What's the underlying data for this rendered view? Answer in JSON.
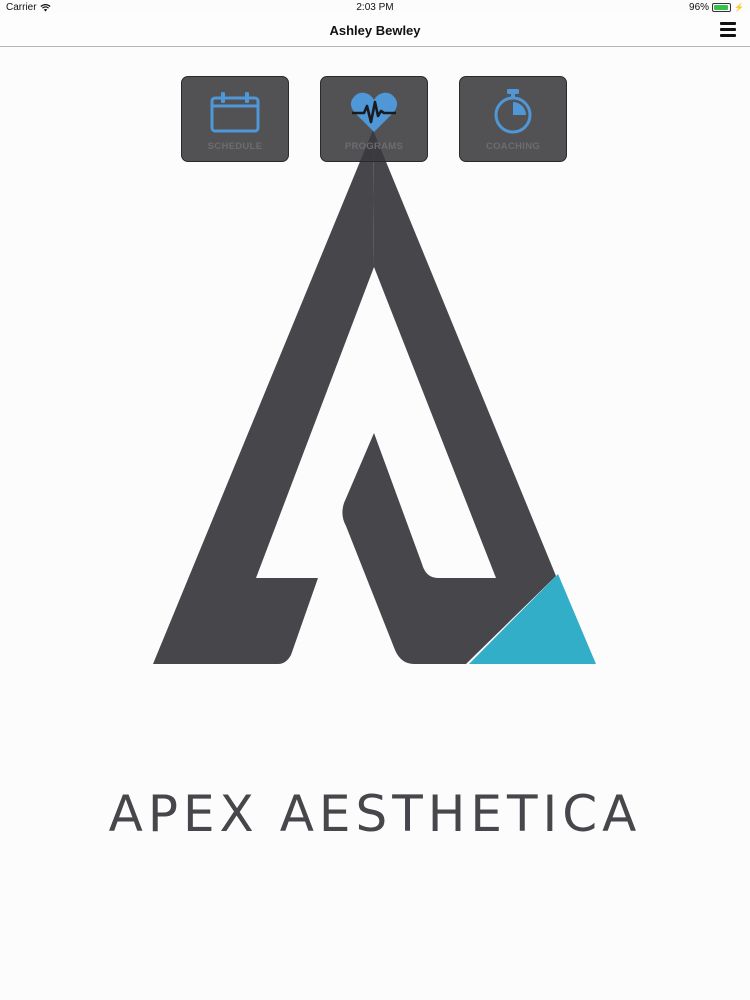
{
  "status_bar": {
    "carrier": "Carrier",
    "time": "2:03 PM",
    "battery_percent": "96%",
    "battery_level": 0.96,
    "wifi_icon": "wifi-icon",
    "charging_icon": "lightning-icon"
  },
  "nav": {
    "title": "Ashley Bewley",
    "menu_icon": "hamburger-menu-icon"
  },
  "tabs": [
    {
      "label": "SCHEDULE",
      "icon": "calendar-icon"
    },
    {
      "label": "PROGRAMS",
      "icon": "heart-pulse-icon"
    },
    {
      "label": "COACHING",
      "icon": "stopwatch-icon"
    }
  ],
  "brand": {
    "name": "APEX AESTHETICA",
    "colors": {
      "logo_dark": "#47474b",
      "logo_accent": "#33aec8",
      "icon_blue": "#4f97d6"
    }
  }
}
